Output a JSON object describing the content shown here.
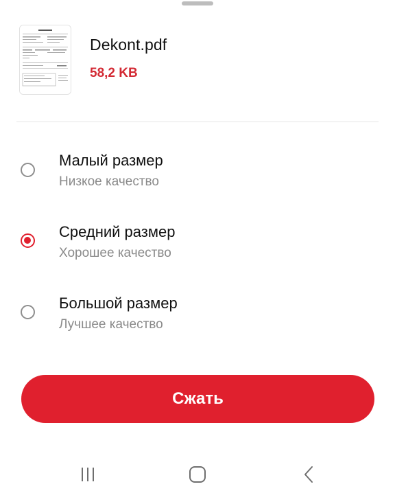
{
  "file": {
    "name": "Dekont.pdf",
    "size": "58,2 KB",
    "thumbnail_icon": "pdf-preview-thumbnail"
  },
  "options": [
    {
      "title": "Малый размер",
      "subtitle": "Низкое качество",
      "selected": false
    },
    {
      "title": "Средний размер",
      "subtitle": "Хорошее качество",
      "selected": true
    },
    {
      "title": "Большой размер",
      "subtitle": "Лучшее качество",
      "selected": false
    }
  ],
  "action": {
    "compress_label": "Сжать"
  },
  "colors": {
    "accent": "#e0202e",
    "size_text": "#d32a34",
    "subtitle": "#8a8a8a"
  },
  "navbar": {
    "icons": [
      "recent-apps-icon",
      "home-icon",
      "back-icon"
    ]
  }
}
